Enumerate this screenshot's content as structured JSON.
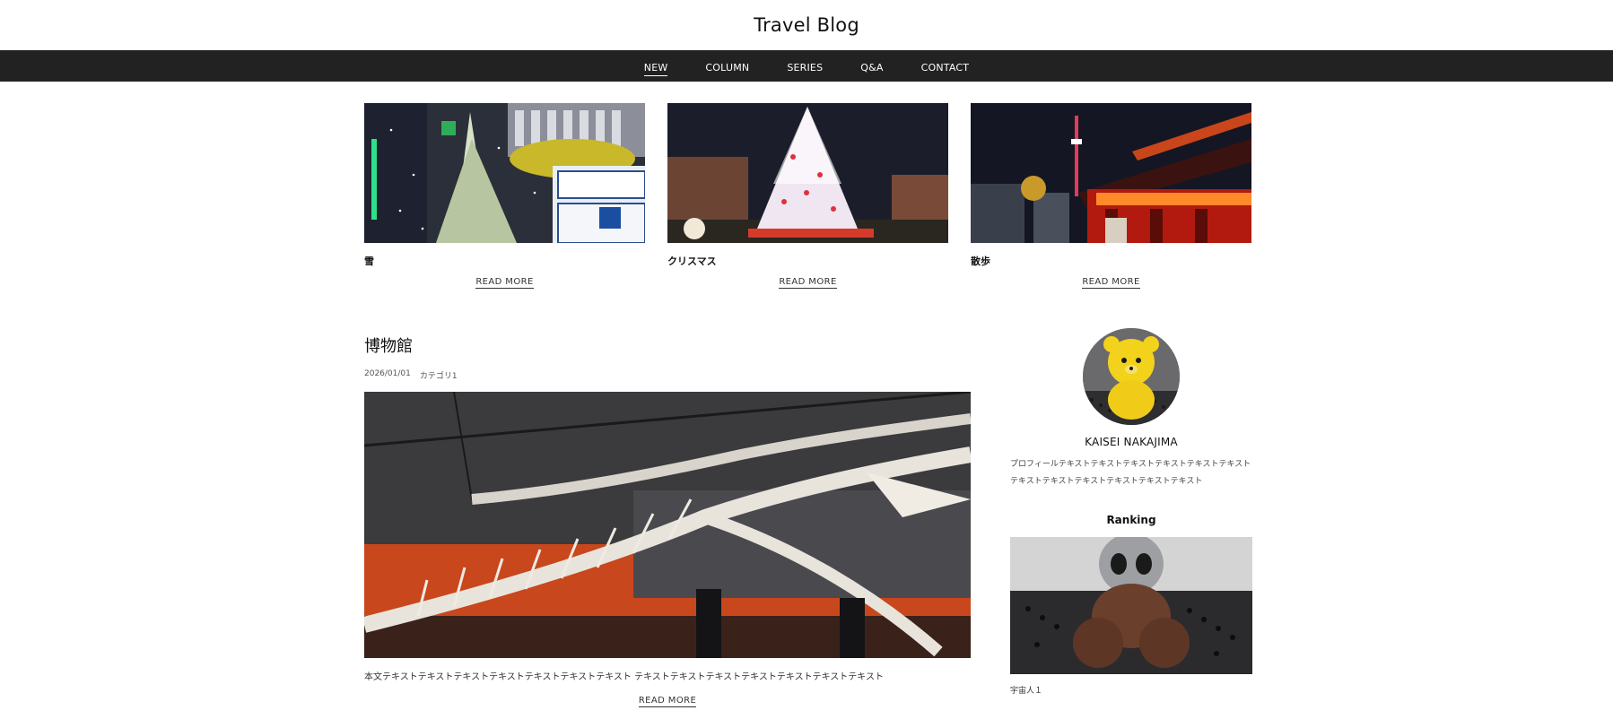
{
  "header": {
    "title": "Travel Blog"
  },
  "nav": {
    "items": [
      {
        "label": "NEW",
        "active": true
      },
      {
        "label": "COLUMN",
        "active": false
      },
      {
        "label": "SERIES",
        "active": false
      },
      {
        "label": "Q&A",
        "active": false
      },
      {
        "label": "CONTACT",
        "active": false
      }
    ]
  },
  "pickup": [
    {
      "title": "雪",
      "read_more": "READ MORE"
    },
    {
      "title": "クリスマス",
      "read_more": "READ MORE"
    },
    {
      "title": "散歩",
      "read_more": "READ MORE"
    }
  ],
  "main_post": {
    "title": "博物館",
    "date": "2026/01/01",
    "category": "カテゴリ1",
    "excerpt": "本文テキストテキストテキストテキストテキストテキストテキスト テキストテキストテキストテキストテキストテキストテキスト",
    "read_more": "READ MORE"
  },
  "sidebar": {
    "profile": {
      "name": "KAISEI NAKAJIMA",
      "text": "プロフィールテキストテキストテキストテキストテキストテキスト テキストテキストテキストテキストテキストテキスト"
    },
    "ranking": {
      "heading": "Ranking",
      "items": [
        {
          "title": "宇宙人１"
        }
      ]
    }
  },
  "colors": {
    "nav_bg": "#222222",
    "text": "#222222",
    "background": "#ffffff"
  }
}
